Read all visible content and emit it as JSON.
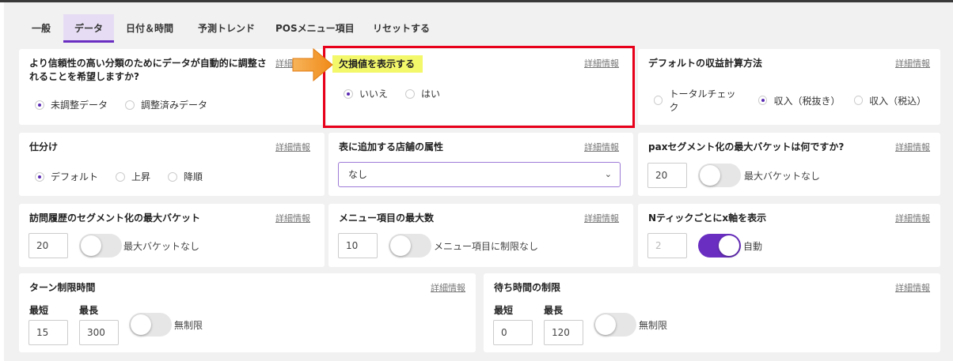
{
  "tabs": [
    "一般",
    "データ",
    "日付＆時間",
    "予測トレンド",
    "POSメニュー項目",
    "リセットする"
  ],
  "active_tab": "データ",
  "detail_label": "詳細情報",
  "auto_adjust": {
    "title": "より信頼性の高い分類のためにデータが自動的に調整されることを希望しますか?",
    "options": [
      "未調整データ",
      "調整済みデータ"
    ],
    "selected": "未調整データ",
    "detail_visible": "詳細"
  },
  "missing_values": {
    "title": "欠損値を表示する",
    "options": [
      "いいえ",
      "はい"
    ],
    "selected": "いいえ"
  },
  "default_revenue": {
    "title": "デフォルトの収益計算方法",
    "options": [
      "トータルチェック",
      "収入（税抜き）",
      "収入（税込）"
    ],
    "selected": "収入（税抜き）"
  },
  "sort": {
    "title": "仕分け",
    "options": [
      "デフォルト",
      "上昇",
      "降順"
    ],
    "selected": "デフォルト"
  },
  "store_attr": {
    "title": "表に追加する店舗の属性",
    "value": "なし"
  },
  "pax_bucket": {
    "title": "paxセグメント化の最大バケットは何ですか?",
    "value": "20",
    "toggle_label": "最大バケットなし",
    "toggle_on": false
  },
  "visit_bucket": {
    "title": "訪問履歴のセグメント化の最大バケット",
    "value": "20",
    "toggle_label": "最大バケットなし",
    "toggle_on": false
  },
  "menu_max": {
    "title": "メニュー項目の最大数",
    "value": "10",
    "toggle_label": "メニュー項目に制限なし",
    "toggle_on": false
  },
  "nth_tick": {
    "title": "Nティックごとにx軸を表示",
    "value": "2",
    "toggle_label": "自動",
    "toggle_on": true
  },
  "turn_limit": {
    "title": "ターン制限時間",
    "min_label": "最短",
    "max_label": "最長",
    "min_value": "15",
    "max_value": "300",
    "toggle_label": "無制限",
    "toggle_on": false
  },
  "wait_limit": {
    "title": "待ち時間の制限",
    "min_label": "最短",
    "max_label": "最長",
    "min_value": "0",
    "max_value": "120",
    "toggle_label": "無制限",
    "toggle_on": false
  },
  "colors": {
    "accent": "#6a2fc1",
    "highlight_border": "#e8001a",
    "highlight_fill": "#f3f86b",
    "arrow": "#f39a2c"
  }
}
